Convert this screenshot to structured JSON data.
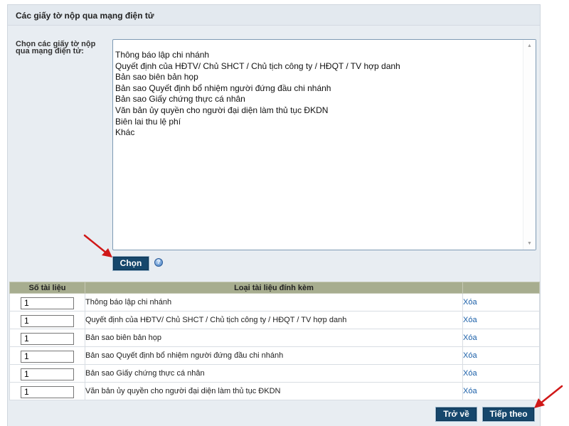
{
  "panel": {
    "title": "Các giấy tờ nộp qua mạng điện tử"
  },
  "select": {
    "label": "Chọn các giấy tờ nộp qua mạng điện tử:",
    "options": [
      "Thông báo lập chi nhánh",
      "Quyết định của HĐTV/ Chủ SHCT / Chủ tịch công ty / HĐQT / TV hợp danh",
      "Bản sao biên bản họp",
      "Bản sao Quyết định bổ nhiệm người đứng đầu chi nhánh",
      "Bản sao Giấy chứng thực cá nhân",
      "Văn bản ủy quyền cho người đại diện làm thủ tục ĐKDN",
      "Biên lai thu lệ phí",
      "Khác"
    ],
    "choose_button": "Chọn",
    "help_glyph": "?"
  },
  "table": {
    "headers": {
      "count": "Số tài liệu",
      "type": "Loại tài liệu đính kèm",
      "action": ""
    },
    "rows": [
      {
        "count": "1",
        "type": "Thông báo lập chi nhánh",
        "action": "Xóa"
      },
      {
        "count": "1",
        "type": "Quyết định của HĐTV/ Chủ SHCT / Chủ tịch công ty / HĐQT / TV hợp danh",
        "action": "Xóa"
      },
      {
        "count": "1",
        "type": "Bản sao biên bản họp",
        "action": "Xóa"
      },
      {
        "count": "1",
        "type": "Bản sao Quyết định bổ nhiệm người đứng đầu chi nhánh",
        "action": "Xóa"
      },
      {
        "count": "1",
        "type": "Bản sao Giấy chứng thực cá nhân",
        "action": "Xóa"
      },
      {
        "count": "1",
        "type": "Văn bản ủy quyền cho người đại diện làm thủ tục ĐKDN",
        "action": "Xóa"
      }
    ]
  },
  "footer": {
    "back_button": "Trở về",
    "next_button": "Tiếp theo"
  },
  "icons": {
    "scroll_up": "scroll-up-arrow-icon",
    "scroll_down": "scroll-down-arrow-icon",
    "help": "help-icon",
    "pointer_arrow": "red-arrow-icon"
  },
  "colors": {
    "button_bg": "#16476c",
    "header_row": "#a7ad8f",
    "link": "#1a5fa8",
    "arrow": "#d01818"
  }
}
